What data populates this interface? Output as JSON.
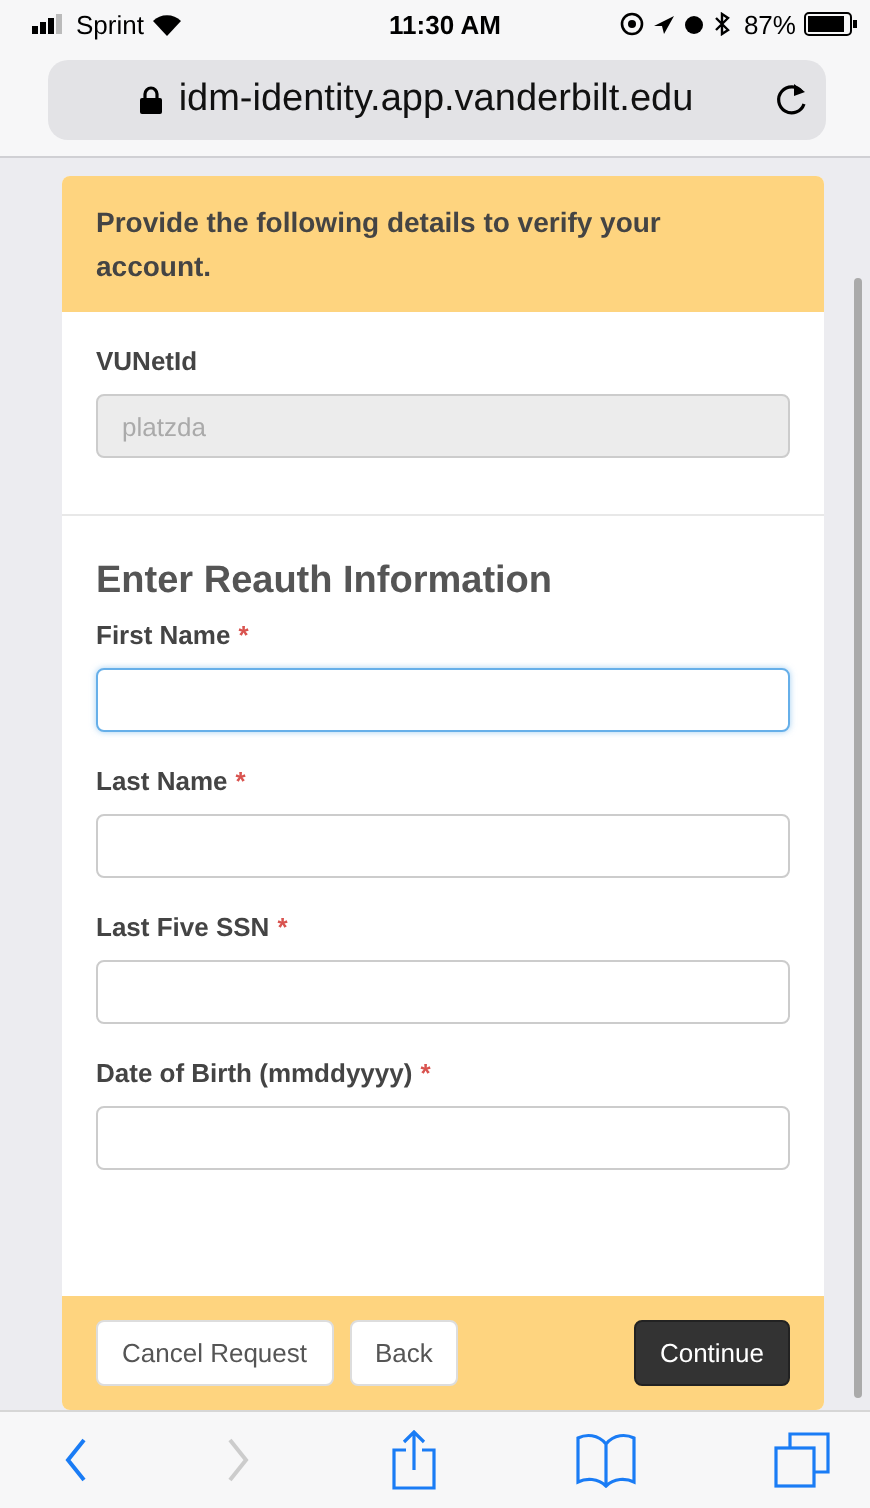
{
  "status_bar": {
    "carrier": "Sprint",
    "time": "11:30 AM",
    "battery": "87%"
  },
  "address_bar": {
    "url": "idm-identity.app.vanderbilt.edu"
  },
  "form": {
    "notice": "Provide the following details to verify your account.",
    "account_field": {
      "label": "VUNetId",
      "value": "platzda",
      "disabled": true
    },
    "section_title": "Enter Reauth Information",
    "fields": [
      {
        "label": "First Name",
        "required_mark": "*",
        "focused": true
      },
      {
        "label": "Last Name",
        "required_mark": "*",
        "focused": false
      },
      {
        "label": "Last Five SSN",
        "required_mark": "*",
        "focused": false
      },
      {
        "label": "Date of Birth (mmddyyyy)",
        "required_mark": "*",
        "focused": false
      }
    ],
    "buttons": [
      {
        "label": "Cancel Request",
        "kind": "secondary"
      },
      {
        "label": "Back",
        "kind": "secondary"
      },
      {
        "label": "Continue",
        "kind": "primary"
      }
    ]
  },
  "toolbar": {
    "back_disabled": false,
    "forward_disabled": true
  }
}
